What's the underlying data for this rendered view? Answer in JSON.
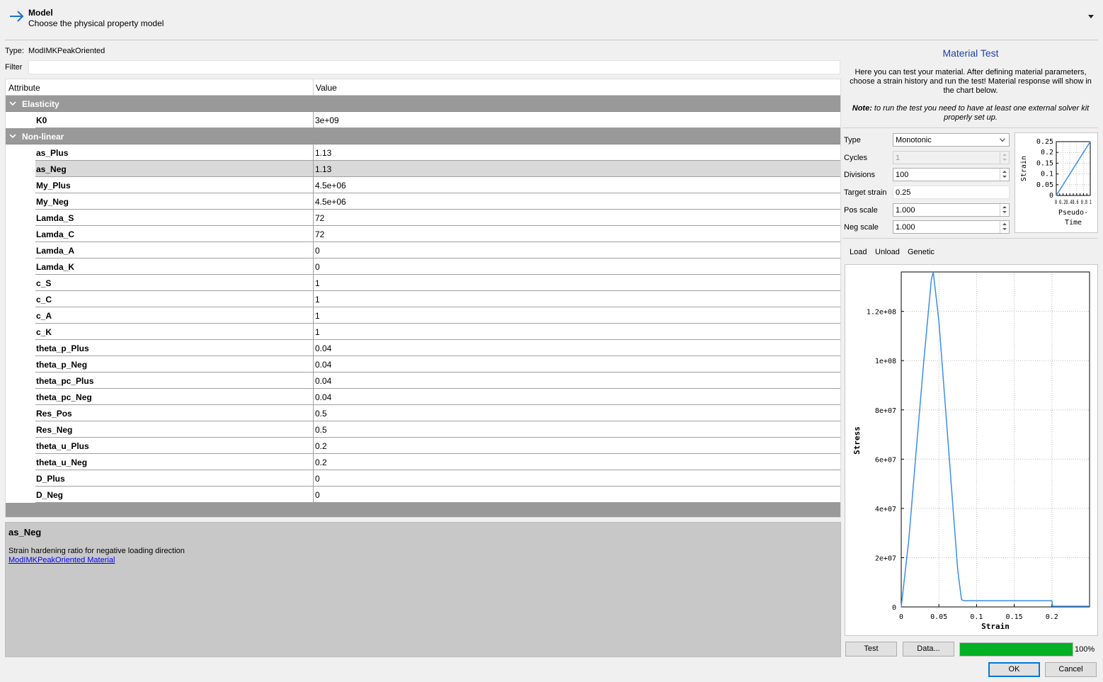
{
  "header": {
    "title": "Model",
    "subtitle": "Choose the physical property model"
  },
  "type_row": {
    "label": "Type:",
    "value": "ModIMKPeakOriented"
  },
  "filter": {
    "label": "Filter",
    "value": ""
  },
  "grid": {
    "col_attribute": "Attribute",
    "col_value": "Value",
    "groups": [
      {
        "name": "Elasticity",
        "rows": [
          {
            "name": "K0",
            "value": "3e+09"
          }
        ]
      },
      {
        "name": "Non-linear",
        "rows": [
          {
            "name": "as_Plus",
            "value": "1.13"
          },
          {
            "name": "as_Neg",
            "value": "1.13"
          },
          {
            "name": "My_Plus",
            "value": "4.5e+06"
          },
          {
            "name": "My_Neg",
            "value": "4.5e+06"
          },
          {
            "name": "Lamda_S",
            "value": "72"
          },
          {
            "name": "Lamda_C",
            "value": "72"
          },
          {
            "name": "Lamda_A",
            "value": "0"
          },
          {
            "name": "Lamda_K",
            "value": "0"
          },
          {
            "name": "c_S",
            "value": "1"
          },
          {
            "name": "c_C",
            "value": "1"
          },
          {
            "name": "c_A",
            "value": "1"
          },
          {
            "name": "c_K",
            "value": "1"
          },
          {
            "name": "theta_p_Plus",
            "value": "0.04"
          },
          {
            "name": "theta_p_Neg",
            "value": "0.04"
          },
          {
            "name": "theta_pc_Plus",
            "value": "0.04"
          },
          {
            "name": "theta_pc_Neg",
            "value": "0.04"
          },
          {
            "name": "Res_Pos",
            "value": "0.5"
          },
          {
            "name": "Res_Neg",
            "value": "0.5"
          },
          {
            "name": "theta_u_Plus",
            "value": "0.2"
          },
          {
            "name": "theta_u_Neg",
            "value": "0.2"
          },
          {
            "name": "D_Plus",
            "value": "0"
          },
          {
            "name": "D_Neg",
            "value": "0"
          }
        ]
      }
    ],
    "selected": "as_Neg"
  },
  "description": {
    "title": "as_Neg",
    "text": "Strain hardening ratio for negative loading direction",
    "link": "ModIMKPeakOriented Material"
  },
  "material_test": {
    "title": "Material Test",
    "intro": "Here you can test your material. After defining material parameters, choose a strain history and run the test! Material response will show in the chart below.",
    "note_label": "Note:",
    "note_text": " to run the test you need to have at least one external solver kit properly set up.",
    "params": {
      "type_label": "Type",
      "type_value": "Monotonic",
      "cycles_label": "Cycles",
      "cycles_value": "1",
      "divisions_label": "Divisions",
      "divisions_value": "100",
      "target_label": "Target strain",
      "target_value": "0.25",
      "pos_label": "Pos scale",
      "pos_value": "1.000",
      "neg_label": "Neg scale",
      "neg_value": "1.000"
    },
    "tabs": [
      "Load",
      "Unload",
      "Genetic"
    ],
    "buttons": {
      "test": "Test",
      "data": "Data...",
      "ok": "OK",
      "cancel": "Cancel"
    },
    "progress": 100,
    "progress_label": "100%"
  },
  "colors": {
    "accent": "#1e3fa8",
    "line": "#3a8ee6",
    "progress": "#06b025",
    "group": "#999999"
  },
  "chart_data": [
    {
      "type": "line",
      "xlabel": "Pseudo-Time",
      "ylabel": "Strain",
      "ylim": [
        0,
        0.25
      ],
      "yticks": [
        "0",
        "0.05",
        "0.1",
        "0.15",
        "0.2",
        "0.25"
      ],
      "xtick_text": "0 0.20.40.6 0.8 1",
      "x": [
        0,
        1
      ],
      "y": [
        0,
        0.25
      ],
      "grid": true
    },
    {
      "type": "line",
      "xlabel": "Strain",
      "ylabel": "Stress",
      "xlim": [
        0,
        0.25
      ],
      "ylim": [
        0,
        136000000.0
      ],
      "xticks": [
        0,
        0.05,
        0.1,
        0.15,
        0.2
      ],
      "xtick_labels": [
        "0",
        "0.05",
        "0.1",
        "0.15",
        "0.2"
      ],
      "yticks": [
        0,
        20000000.0,
        40000000.0,
        60000000.0,
        80000000.0,
        100000000.0,
        120000000.0
      ],
      "ytick_labels": [
        "0",
        "2e+07",
        "4e+07",
        "6e+07",
        "8e+07",
        "1e+08",
        "1.2e+08"
      ],
      "x": [
        0,
        0.01,
        0.02,
        0.03,
        0.04,
        0.0425,
        0.05,
        0.06,
        0.07,
        0.075,
        0.08,
        0.0825,
        0.085,
        0.19,
        0.2,
        0.201,
        0.25
      ],
      "y": [
        0,
        27000000.0,
        64000000.0,
        100000000.0,
        133000000.0,
        136000000.0,
        116000000.0,
        76000000.0,
        35000000.0,
        15000000.0,
        3000000.0,
        2600000.0,
        2500000.0,
        2500000.0,
        2500000.0,
        300000.0,
        300000.0
      ],
      "grid": true
    }
  ]
}
